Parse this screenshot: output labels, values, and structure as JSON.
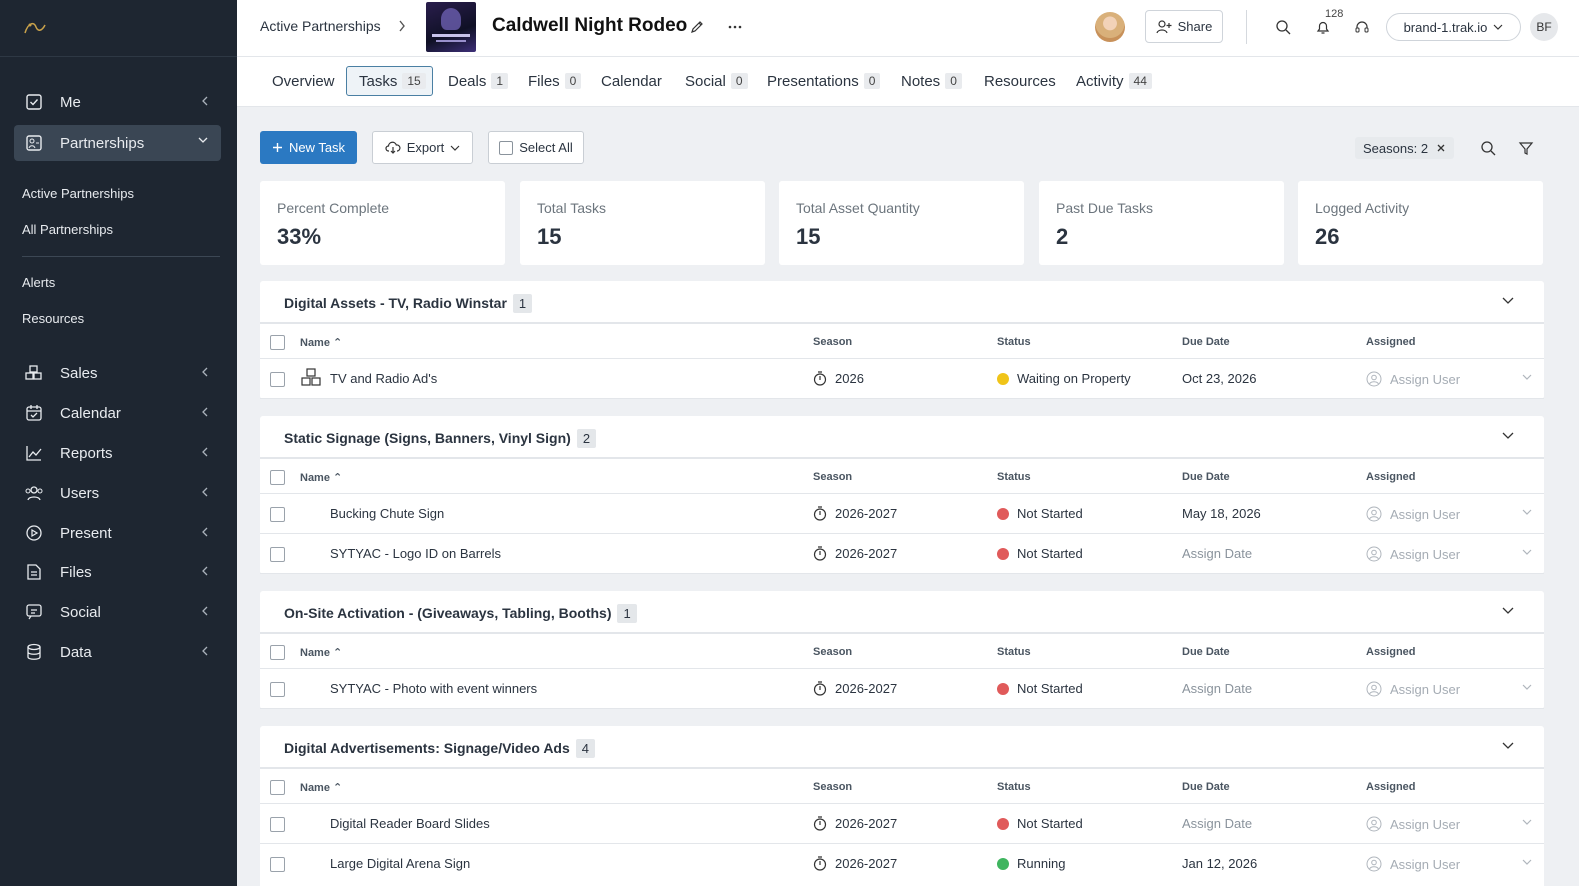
{
  "colors": {
    "primary": "#2b79c2",
    "sidebar_bg": "#1e2631",
    "status_waiting": "#f0c419",
    "status_not_started": "#e05a5a",
    "status_running": "#3fb55f"
  },
  "sidebar": {
    "logo_icon": "brand-logo-icon",
    "nav": [
      {
        "label": "Me",
        "icon": "checkbox-icon"
      },
      {
        "label": "Partnerships",
        "icon": "partnerships-icon"
      },
      {
        "label": "Sales",
        "icon": "sales-icon"
      },
      {
        "label": "Calendar",
        "icon": "calendar-icon"
      },
      {
        "label": "Reports",
        "icon": "reports-icon"
      },
      {
        "label": "Users",
        "icon": "users-icon"
      },
      {
        "label": "Present",
        "icon": "present-icon"
      },
      {
        "label": "Files",
        "icon": "files-icon"
      },
      {
        "label": "Social",
        "icon": "social-icon"
      },
      {
        "label": "Data",
        "icon": "data-icon"
      }
    ],
    "sub": [
      "Active Partnerships",
      "All Partnerships",
      "Alerts",
      "Resources"
    ]
  },
  "header": {
    "breadcrumb": "Active Partnerships",
    "title": "Caldwell Night Rodeo",
    "share_label": "Share",
    "notification_count": "128",
    "domain": "brand-1.trak.io",
    "initials": "BF"
  },
  "tabs": [
    {
      "label": "Overview",
      "count": ""
    },
    {
      "label": "Tasks",
      "count": "15"
    },
    {
      "label": "Deals",
      "count": "1"
    },
    {
      "label": "Files",
      "count": "0"
    },
    {
      "label": "Calendar",
      "count": ""
    },
    {
      "label": "Social",
      "count": "0"
    },
    {
      "label": "Presentations",
      "count": "0"
    },
    {
      "label": "Notes",
      "count": "0"
    },
    {
      "label": "Resources",
      "count": ""
    },
    {
      "label": "Activity",
      "count": "44"
    }
  ],
  "toolbar": {
    "new_task": "New Task",
    "export": "Export",
    "select_all": "Select All",
    "filter_chip": "Seasons: 2"
  },
  "stats": [
    {
      "label": "Percent Complete",
      "value": "33%"
    },
    {
      "label": "Total Tasks",
      "value": "15"
    },
    {
      "label": "Total Asset Quantity",
      "value": "15"
    },
    {
      "label": "Past Due Tasks",
      "value": "2"
    },
    {
      "label": "Logged Activity",
      "value": "26"
    }
  ],
  "columns": {
    "name": "Name",
    "season": "Season",
    "status": "Status",
    "due": "Due Date",
    "assigned": "Assigned"
  },
  "groups": [
    {
      "title": "Digital Assets - TV, Radio Winstar",
      "count": "1",
      "rows": [
        {
          "name": "TV and Radio Ad's",
          "season": "2026",
          "status": "Waiting on Property",
          "status_color": "#f0c419",
          "due": "Oct 23, 2026",
          "assigned": "Assign User"
        }
      ]
    },
    {
      "title": "Static Signage (Signs, Banners, Vinyl Sign)",
      "count": "2",
      "rows": [
        {
          "name": "Bucking Chute Sign",
          "season": "2026-2027",
          "status": "Not Started",
          "status_color": "#e05a5a",
          "due": "May 18, 2026",
          "assigned": "Assign User"
        },
        {
          "name": "SYTYAC - Logo ID on Barrels",
          "season": "2026-2027",
          "status": "Not Started",
          "status_color": "#e05a5a",
          "due": "Assign Date",
          "assigned": "Assign User"
        }
      ]
    },
    {
      "title": "On-Site Activation - (Giveaways, Tabling, Booths)",
      "count": "1",
      "rows": [
        {
          "name": "SYTYAC - Photo with event winners",
          "season": "2026-2027",
          "status": "Not Started",
          "status_color": "#e05a5a",
          "due": "Assign Date",
          "assigned": "Assign User"
        }
      ]
    },
    {
      "title": "Digital Advertisements: Signage/Video Ads",
      "count": "4",
      "rows": [
        {
          "name": "Digital Reader Board Slides",
          "season": "2026-2027",
          "status": "Not Started",
          "status_color": "#e05a5a",
          "due": "Assign Date",
          "assigned": "Assign User"
        },
        {
          "name": "Large Digital Arena Sign",
          "season": "2026-2027",
          "status": "Running",
          "status_color": "#3fb55f",
          "due": "Jan 12, 2026",
          "assigned": "Assign User"
        }
      ]
    }
  ]
}
